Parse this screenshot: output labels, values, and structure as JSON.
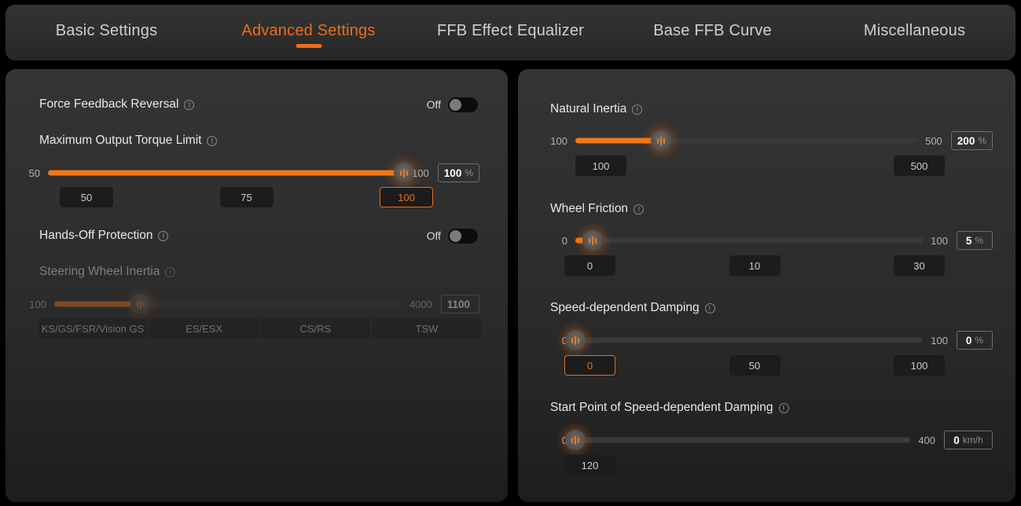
{
  "tabs": [
    {
      "label": "Basic Settings",
      "active": false
    },
    {
      "label": "Advanced Settings",
      "active": true
    },
    {
      "label": "FFB Effect Equalizer",
      "active": false
    },
    {
      "label": "Base FFB Curve",
      "active": false
    },
    {
      "label": "Miscellaneous",
      "active": false
    }
  ],
  "colors": {
    "accent": "#ef6c16",
    "slider_fill": "#f07818",
    "track": "#3a3a3a",
    "panel_bg": "#2f2f2f",
    "page_bg": "#000000",
    "text": "#e8e8e8"
  },
  "left_panel": {
    "force_feedback_reversal": {
      "title": "Force Feedback Reversal",
      "info_icon": "info-circle-icon",
      "toggle_label": "Off",
      "toggle_state": "off"
    },
    "maximum_output_torque_limit": {
      "title": "Maximum Output Torque Limit",
      "info_icon": "info-circle-icon",
      "min": "50",
      "max": "100",
      "value": "100",
      "unit": "%",
      "fill_percent": 100,
      "presets": [
        {
          "label": "50",
          "selected": false
        },
        {
          "label": "75",
          "selected": false
        },
        {
          "label": "100",
          "selected": true
        }
      ]
    },
    "hands_off_protection": {
      "title": "Hands-Off Protection",
      "info_icon": "info-circle-icon",
      "toggle_label": "Off",
      "toggle_state": "off"
    },
    "steering_wheel_inertia": {
      "title": "Steering Wheel Inertia",
      "info_icon": "info-circle-icon",
      "disabled": true,
      "min": "100",
      "max": "4000",
      "value": "1100",
      "unit": "",
      "fill_percent": 25,
      "presets": [
        {
          "label": "KS/GS/FSR/Vision GS",
          "selected": false
        },
        {
          "label": "ES/ESX",
          "selected": false
        },
        {
          "label": "CS/RS",
          "selected": false
        },
        {
          "label": "TSW",
          "selected": false
        }
      ]
    }
  },
  "right_panel": {
    "natural_inertia": {
      "title": "Natural Inertia",
      "info_icon": "info-circle-icon",
      "min": "100",
      "max": "500",
      "value": "200",
      "unit": "%",
      "fill_percent": 25,
      "presets": [
        {
          "label": "100",
          "selected": false
        },
        {
          "label": "500",
          "selected": false
        }
      ]
    },
    "wheel_friction": {
      "title": "Wheel Friction",
      "info_icon": "info-circle-icon",
      "min": "0",
      "max": "100",
      "value": "5",
      "unit": "%",
      "fill_percent": 5,
      "presets": [
        {
          "label": "0",
          "selected": false
        },
        {
          "label": "10",
          "selected": false
        },
        {
          "label": "30",
          "selected": false
        }
      ]
    },
    "speed_dependent_damping": {
      "title": "Speed-dependent Damping",
      "info_icon": "info-circle-icon",
      "min": "0",
      "max": "100",
      "value": "0",
      "unit": "%",
      "fill_percent": 0,
      "presets": [
        {
          "label": "0",
          "selected": true
        },
        {
          "label": "50",
          "selected": false
        },
        {
          "label": "100",
          "selected": false
        }
      ]
    },
    "start_point_of_speed_dependent_damping": {
      "title": "Start Point of Speed-dependent Damping",
      "info_icon": "info-circle-icon",
      "min": "0",
      "max": "400",
      "value": "0",
      "unit": "km/h",
      "fill_percent": 0,
      "presets": [
        {
          "label": "120",
          "selected": false
        }
      ]
    }
  }
}
